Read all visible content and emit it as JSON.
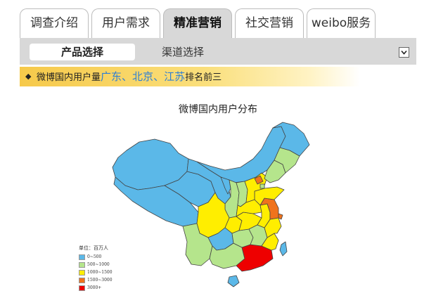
{
  "tabs": [
    {
      "label": "调查介绍",
      "active": false
    },
    {
      "label": "用户需求",
      "active": false
    },
    {
      "label": "精准营销",
      "active": true
    },
    {
      "label": "社交营销",
      "active": false
    },
    {
      "label": "weibo服务",
      "active": false
    }
  ],
  "subnav": {
    "active_label": "产品选择",
    "other_label": "渠道选择",
    "dropdown_icon": "chevron-down-icon"
  },
  "banner": {
    "prefix": "微博国内用户量",
    "highlights": [
      "广东",
      "北京",
      "江苏"
    ],
    "separator": "、",
    "suffix": "排名前三"
  },
  "map": {
    "title": "微博国内用户分布",
    "legend": {
      "unit": "单位：百万人",
      "items": [
        {
          "label": "0~500",
          "color": "#5bb8e8"
        },
        {
          "label": "500~1000",
          "color": "#b5e58c"
        },
        {
          "label": "1000~1500",
          "color": "#ffee00"
        },
        {
          "label": "1500~3000",
          "color": "#f0731c"
        },
        {
          "label": "3000+",
          "color": "#ee0000"
        }
      ]
    },
    "provinces": {
      "xinjiang": "0~500",
      "xizang": "0~500",
      "qinghai": "0~500",
      "gansu": "0~500",
      "neimenggu": "0~500",
      "ningxia": "0~500",
      "shaanxi": "500~1000",
      "sichuan": "1000~1500",
      "yunnan": "500~1000",
      "guizhou": "0~500",
      "chongqing": "1000~1500",
      "heilongjiang": "0~500",
      "jilin": "500~1000",
      "liaoning": "500~1000",
      "hebei": "1000~1500",
      "beijing": "1500~3000",
      "tianjin": "500~1000",
      "shanxi": "500~1000",
      "shandong": "1000~1500",
      "henan": "1000~1500",
      "hubei": "1000~1500",
      "hunan": "500~1000",
      "anhui": "1000~1500",
      "jiangsu": "1500~3000",
      "shanghai": "1500~3000",
      "zhejiang": "1000~1500",
      "jiangxi": "500~1000",
      "fujian": "1000~1500",
      "guangdong": "3000+",
      "guangxi": "500~1000",
      "hainan": "0~500",
      "taiwan": "0~500"
    }
  },
  "colors": {
    "tab_active_bg": "#d8d8d8",
    "banner_highlight": "#2f7fd4"
  }
}
